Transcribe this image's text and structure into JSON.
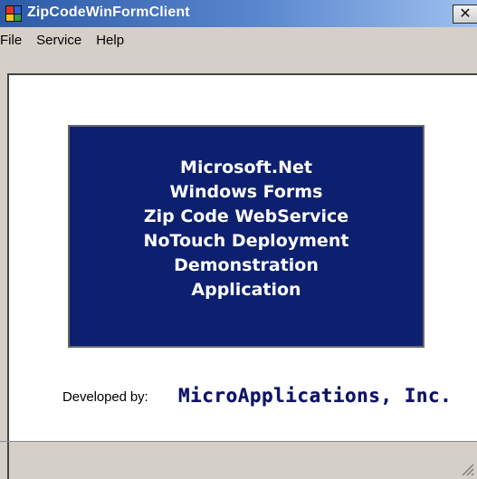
{
  "window": {
    "title": "ZipCodeWinFormClient",
    "close_label": "✕"
  },
  "menubar": {
    "items": [
      {
        "label": "File"
      },
      {
        "label": "Service"
      },
      {
        "label": "Help"
      }
    ]
  },
  "main": {
    "banner_lines": [
      "Microsoft.Net",
      "Windows Forms",
      "Zip Code WebService",
      "NoTouch Deployment",
      "Demonstration",
      "Application"
    ],
    "developed_label": "Developed by:",
    "company_name": "MicroApplications, Inc."
  },
  "colors": {
    "banner_background": "#0d2070",
    "banner_text": "#ffffff",
    "company_text": "#0f1366",
    "titlebar_start": "#2d5aa6",
    "titlebar_end": "#9fc0ee"
  },
  "icons": {
    "app_icon": "app-icon",
    "close_icon": "close-icon",
    "resize_grip": "resize-grip-icon"
  }
}
